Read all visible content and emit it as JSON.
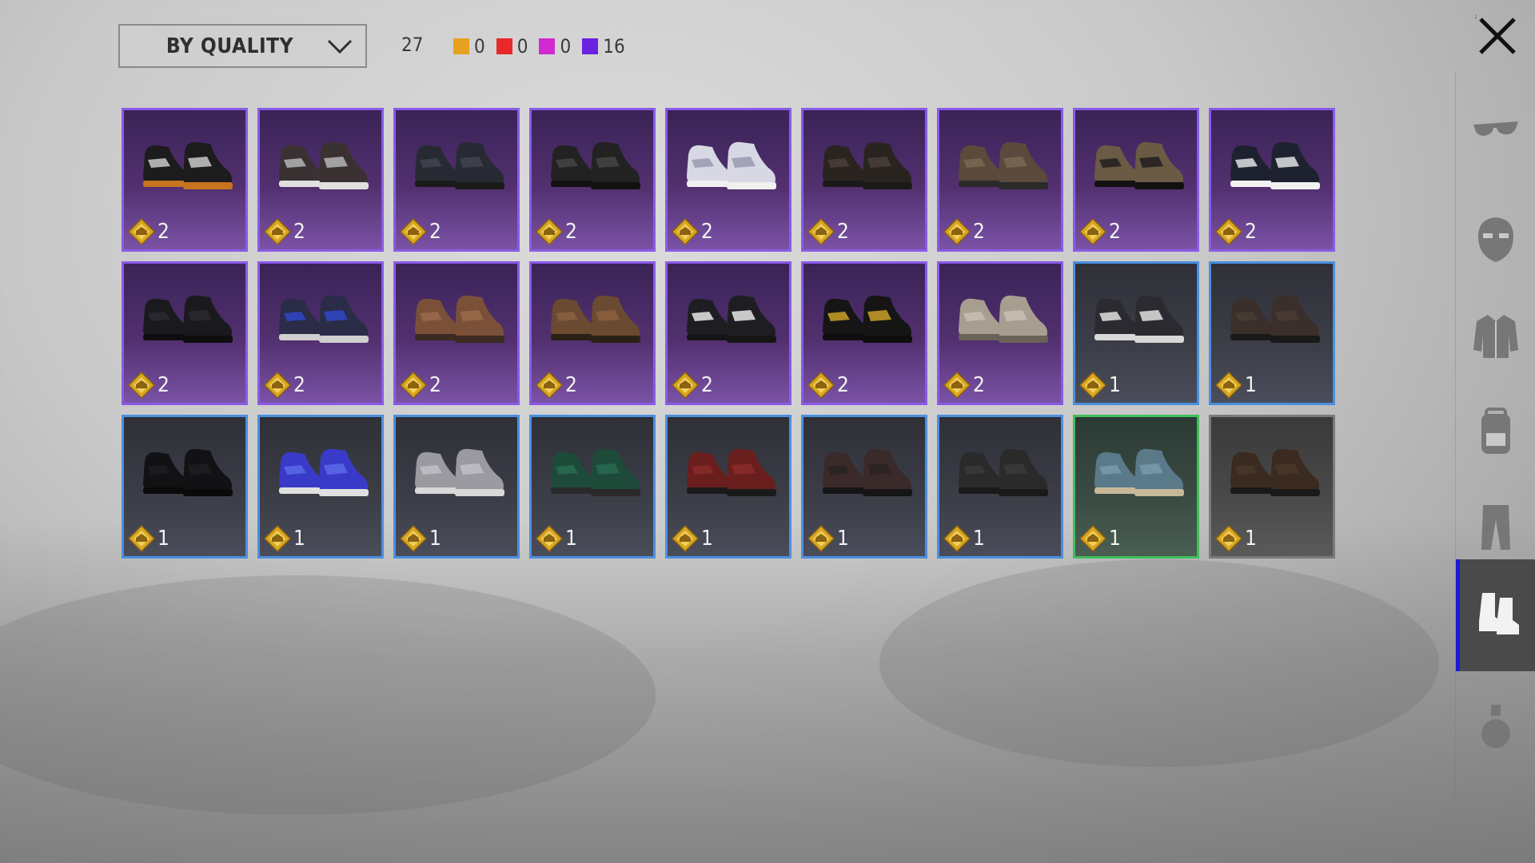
{
  "toolbar": {
    "sort_label": "BY QUALITY",
    "total_count": "27",
    "quality_counts": [
      {
        "color": "#e8a020",
        "count": "0"
      },
      {
        "color": "#e8282a",
        "count": "0"
      },
      {
        "color": "#d22ad2",
        "count": "0"
      },
      {
        "color": "#6a22e0",
        "count": "16"
      }
    ]
  },
  "items": [
    {
      "level": "2",
      "quality": "purple",
      "colors": [
        "#1c1c1c",
        "#c9c9c9"
      ],
      "sole": "#c7741e"
    },
    {
      "level": "2",
      "quality": "purple",
      "colors": [
        "#3a3232",
        "#b5b5b5"
      ],
      "sole": "#e0e0e0"
    },
    {
      "level": "2",
      "quality": "purple",
      "colors": [
        "#272a33",
        "#3f4450"
      ],
      "sole": "#1a1a1a"
    },
    {
      "level": "2",
      "quality": "purple",
      "colors": [
        "#222222",
        "#444444"
      ],
      "sole": "#111111"
    },
    {
      "level": "2",
      "quality": "purple",
      "colors": [
        "#d8d8e4",
        "#9a9ab0"
      ],
      "sole": "#f0f0f0"
    },
    {
      "level": "2",
      "quality": "purple",
      "colors": [
        "#2a2420",
        "#4a4038"
      ],
      "sole": "#1a1a1a"
    },
    {
      "level": "2",
      "quality": "purple",
      "colors": [
        "#5a4a3c",
        "#7a6652"
      ],
      "sole": "#2a2a2a"
    },
    {
      "level": "2",
      "quality": "purple",
      "colors": [
        "#6b5a44",
        "#1e1e1e"
      ],
      "sole": "#111111"
    },
    {
      "level": "2",
      "quality": "purple",
      "colors": [
        "#1e2230",
        "#e0e0e0"
      ],
      "sole": "#f2f2f2"
    },
    {
      "level": "2",
      "quality": "purple",
      "colors": [
        "#1a1a1e",
        "#2a2a30"
      ],
      "sole": "#0e0e0e"
    },
    {
      "level": "2",
      "quality": "purple",
      "colors": [
        "#2a2c48",
        "#2f47c8"
      ],
      "sole": "#cfcfcf"
    },
    {
      "level": "2",
      "quality": "purple",
      "colors": [
        "#7a5038",
        "#9a6a4a"
      ],
      "sole": "#3a2a20"
    },
    {
      "level": "2",
      "quality": "purple",
      "colors": [
        "#6a4a30",
        "#8a6040"
      ],
      "sole": "#2a2018"
    },
    {
      "level": "2",
      "quality": "purple",
      "colors": [
        "#1e1e22",
        "#e8e8e8"
      ],
      "sole": "#151515"
    },
    {
      "level": "2",
      "quality": "purple",
      "colors": [
        "#151515",
        "#c9a028"
      ],
      "sole": "#0e0e0e"
    },
    {
      "level": "2",
      "quality": "purple",
      "colors": [
        "#a89e90",
        "#c8c0b4"
      ],
      "sole": "#6a6258"
    },
    {
      "level": "1",
      "quality": "blue",
      "colors": [
        "#2a2a30",
        "#e0e0e0"
      ],
      "sole": "#d8d8d8"
    },
    {
      "level": "1",
      "quality": "blue",
      "colors": [
        "#3a2f2a",
        "#4a3c34"
      ],
      "sole": "#1a1a1a"
    },
    {
      "level": "1",
      "quality": "blue",
      "colors": [
        "#121214",
        "#1e1e22"
      ],
      "sole": "#0a0a0a"
    },
    {
      "level": "1",
      "quality": "blue",
      "colors": [
        "#3a3ac8",
        "#5a6ae8"
      ],
      "sole": "#e0e0e0"
    },
    {
      "level": "1",
      "quality": "blue",
      "colors": [
        "#9a9aa0",
        "#c0c0c6"
      ],
      "sole": "#d8d8d8"
    },
    {
      "level": "1",
      "quality": "blue",
      "colors": [
        "#1e4a3a",
        "#2a6a52"
      ],
      "sole": "#2a2a2a"
    },
    {
      "level": "1",
      "quality": "blue",
      "colors": [
        "#6a1e1e",
        "#8a2a2a"
      ],
      "sole": "#1a1a1a"
    },
    {
      "level": "1",
      "quality": "blue",
      "colors": [
        "#3a2a2a",
        "#2a2222"
      ],
      "sole": "#151515"
    },
    {
      "level": "1",
      "quality": "blue",
      "colors": [
        "#2a2a2a",
        "#3a3a3a"
      ],
      "sole": "#1a1a1a"
    },
    {
      "level": "1",
      "quality": "green",
      "colors": [
        "#5a7a8a",
        "#7a9aaa"
      ],
      "sole": "#c8b89a"
    },
    {
      "level": "1",
      "quality": "grey",
      "colors": [
        "#3a2a20",
        "#4a382a"
      ],
      "sole": "#1a1a1a"
    }
  ],
  "sidebar": {
    "items": [
      {
        "icon": "glasses-icon",
        "active": false
      },
      {
        "icon": "mask-icon",
        "active": false
      },
      {
        "icon": "jacket-icon",
        "active": false
      },
      {
        "icon": "backpack-icon",
        "active": false
      },
      {
        "icon": "pants-icon",
        "active": false
      },
      {
        "icon": "shoes-icon",
        "active": true
      },
      {
        "icon": "grenade-icon",
        "active": false
      }
    ]
  }
}
